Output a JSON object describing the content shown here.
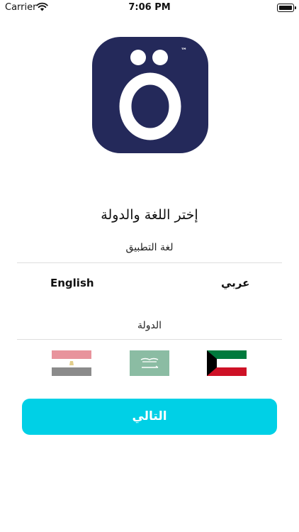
{
  "status_bar": {
    "carrier": "Carrier",
    "time": "7:06 PM"
  },
  "logo": {
    "trademark": "™",
    "background_color": "#24295a"
  },
  "title": "إختر اللغة والدولة",
  "language_section": {
    "label": "لغة التطبيق",
    "options": [
      "English",
      "عربي"
    ],
    "selected": "عربي"
  },
  "country_section": {
    "label": "الدولة",
    "flags": [
      "egypt-flag-icon",
      "saudi-arabia-flag-icon",
      "kuwait-flag-icon"
    ],
    "selected": "kuwait-flag-icon"
  },
  "next_button": {
    "label": "التالي",
    "color": "#00d0e6"
  }
}
